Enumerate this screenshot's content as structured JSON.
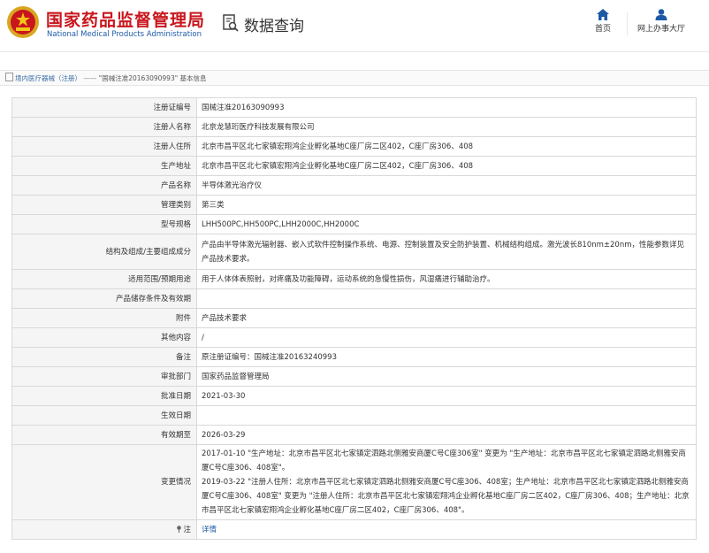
{
  "header": {
    "org_name_cn": "国家药品监督管理局",
    "org_name_en": "National Medical Products Administration",
    "query_title": "数据查询",
    "nav": {
      "home_label": "首页",
      "service_hall_label": "网上办事大厅"
    },
    "brand_color": "#c8161d"
  },
  "breadcrumb": {
    "category": "境内医疗器械（注册）",
    "separator": "——",
    "current": "\"国械注准20163090993\" 基本信息"
  },
  "details": {
    "rows": [
      {
        "label": "注册证编号",
        "value": "国械注准20163090993"
      },
      {
        "label": "注册人名称",
        "value": "北京龙慧珩医疗科技发展有限公司"
      },
      {
        "label": "注册人住所",
        "value": "北京市昌平区北七家镇宏翔鸿企业孵化基地C座厂房二区402，C座厂房306、408"
      },
      {
        "label": "生产地址",
        "value": "北京市昌平区北七家镇宏翔鸿企业孵化基地C座厂房二区402，C座厂房306、408"
      },
      {
        "label": "产品名称",
        "value": "半导体激光治疗仪"
      },
      {
        "label": "管理类别",
        "value": "第三类"
      },
      {
        "label": "型号规格",
        "value": "LHH500PC,HH500PC,LHH2000C,HH2000C"
      },
      {
        "label": "结构及组成/主要组成成分",
        "value": "产品由半导体激光辐射器、嵌入式软件控制操作系统、电源、控制装置及安全防护装置、机械结构组成。激光波长810nm±20nm，性能参数详见产品技术要求。"
      },
      {
        "label": "适用范围/预期用途",
        "value": "用于人体体表照射，对疼痛及功能障碍，运动系统的急慢性损伤，风湿痛进行辅助治疗。"
      },
      {
        "label": "产品储存条件及有效期",
        "value": ""
      },
      {
        "label": "附件",
        "value": "产品技术要求"
      },
      {
        "label": "其他内容",
        "value": "/"
      },
      {
        "label": "备注",
        "value": "原注册证编号：国械注准20163240993"
      },
      {
        "label": "审批部门",
        "value": "国家药品监督管理局"
      },
      {
        "label": "批准日期",
        "value": "2021-03-30"
      },
      {
        "label": "生效日期",
        "value": ""
      },
      {
        "label": "有效期至",
        "value": "2026-03-29"
      }
    ],
    "change_label": "变更情况",
    "change_entries": [
      "2017-01-10 \"生产地址：北京市昌平区北七家镇定泗路北侧雅安商厦C号C座306室\" 变更为 \"生产地址：北京市昌平区北七家镇定泗路北侧雅安商厦C号C座306、408室\"。",
      "2019-03-22 \"注册人住所：北京市昌平区北七家镇定泗路北侧雅安商厦C号C座306、408室；生产地址：北京市昌平区北七家镇定泗路北侧雅安商厦C号C座306、408室\" 变更为 \"注册人住所：北京市昌平区北七家镇宏翔鸿企业孵化基地C座厂房二区402，C座厂房306、408；生产地址：北京市昌平区北七家镇宏翔鸿企业孵化基地C座厂房二区402，C座厂房306、408\"。"
    ],
    "note_label": "注",
    "detail_link": "详情"
  }
}
